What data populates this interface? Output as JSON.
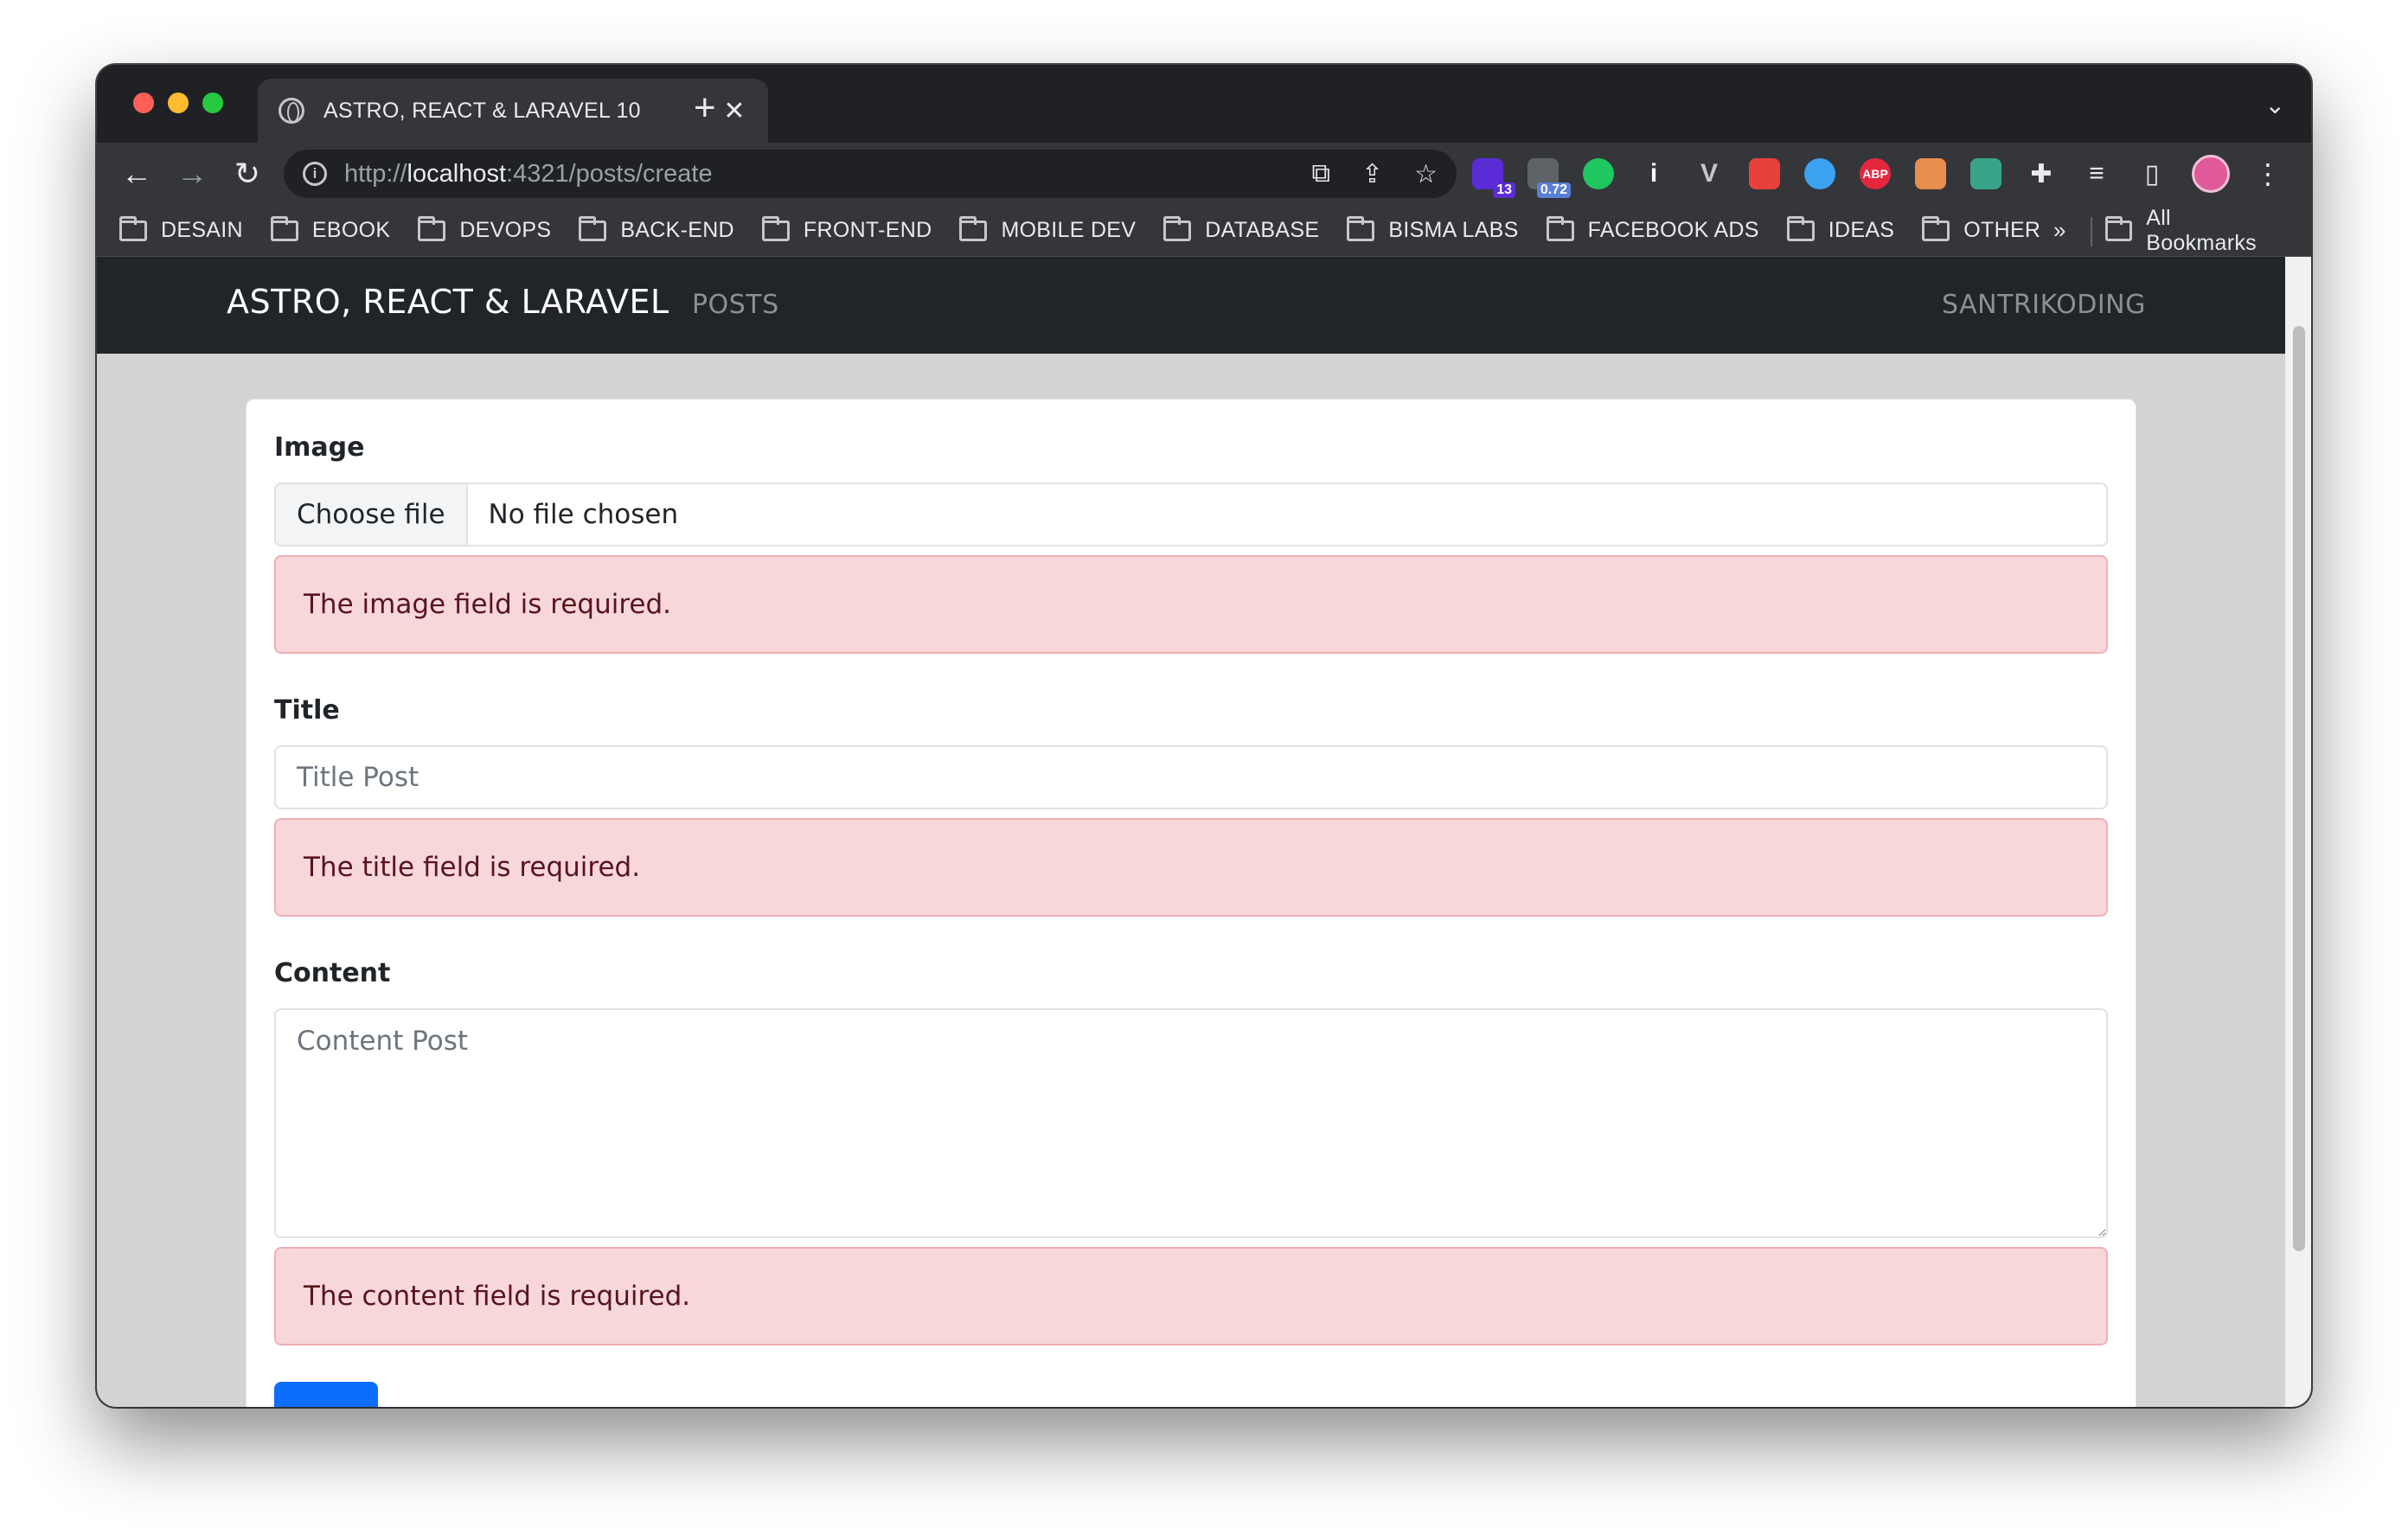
{
  "browser": {
    "tab_title": "ASTRO, REACT & LARAVEL 10",
    "tab_close": "✕",
    "new_tab": "+",
    "tabstrip_menu": "⌄",
    "url_scheme": "http://",
    "url_host": "localhost",
    "url_rest": ":4321/posts/create",
    "nav": {
      "back": "←",
      "forward": "→",
      "reload": "↻"
    },
    "omnibox_icons": {
      "open": "⧉",
      "share": "⇪",
      "star": "☆"
    },
    "extensions": [
      {
        "name": "purple-extension-icon",
        "color": "#5b2bd6",
        "badge": "13",
        "badge_color": "#5b2bd6"
      },
      {
        "name": "metrics-extension-icon",
        "color": "#5f6368",
        "badge": "0.72",
        "badge_color": "#5a7fd6"
      },
      {
        "name": "green-dot-extension-icon",
        "color": "#1ec760"
      },
      {
        "name": "info-extension-icon",
        "color": "#ffffff",
        "glyph": "i"
      },
      {
        "name": "vue-extension-icon",
        "color": "#c5c7ca",
        "glyph": "V"
      },
      {
        "name": "red-extension-icon",
        "color": "#e8413c"
      },
      {
        "name": "color-ring-extension-icon",
        "color": "#3aa2f0"
      },
      {
        "name": "adblock-extension-icon",
        "color": "#e5273e",
        "glyph": "ABP"
      },
      {
        "name": "cookie-extension-icon",
        "color": "#e88e4c"
      },
      {
        "name": "chatgpt-extension-icon",
        "color": "#3aa48a"
      },
      {
        "name": "puzzle-extension-icon",
        "color": "#e8eaed",
        "glyph": "✚"
      },
      {
        "name": "reading-list-icon",
        "color": "#e8eaed",
        "glyph": "≡"
      },
      {
        "name": "side-panel-icon",
        "color": "#e8eaed",
        "glyph": "▯"
      }
    ],
    "kebab": "⋮",
    "bookmarks": [
      "DESAIN",
      "EBOOK",
      "DEVOPS",
      "BACK-END",
      "FRONT-END",
      "MOBILE DEV",
      "DATABASE",
      "BISMA LABS",
      "FACEBOOK ADS",
      "IDEAS",
      "OTHER"
    ],
    "bookmarks_more": "»",
    "all_bookmarks": "All Bookmarks"
  },
  "navbar": {
    "brand": "ASTRO, REACT & LARAVEL",
    "posts": "POSTS",
    "right": "SANTRIKODING"
  },
  "form": {
    "image": {
      "label": "Image",
      "button": "Choose file",
      "status": "No file chosen",
      "error": "The image field is required."
    },
    "title": {
      "label": "Title",
      "placeholder": "Title Post",
      "value": "",
      "error": "The title field is required."
    },
    "content": {
      "label": "Content",
      "placeholder": "Content Post",
      "value": "",
      "error": "The content field is required."
    },
    "submit_label": ""
  }
}
